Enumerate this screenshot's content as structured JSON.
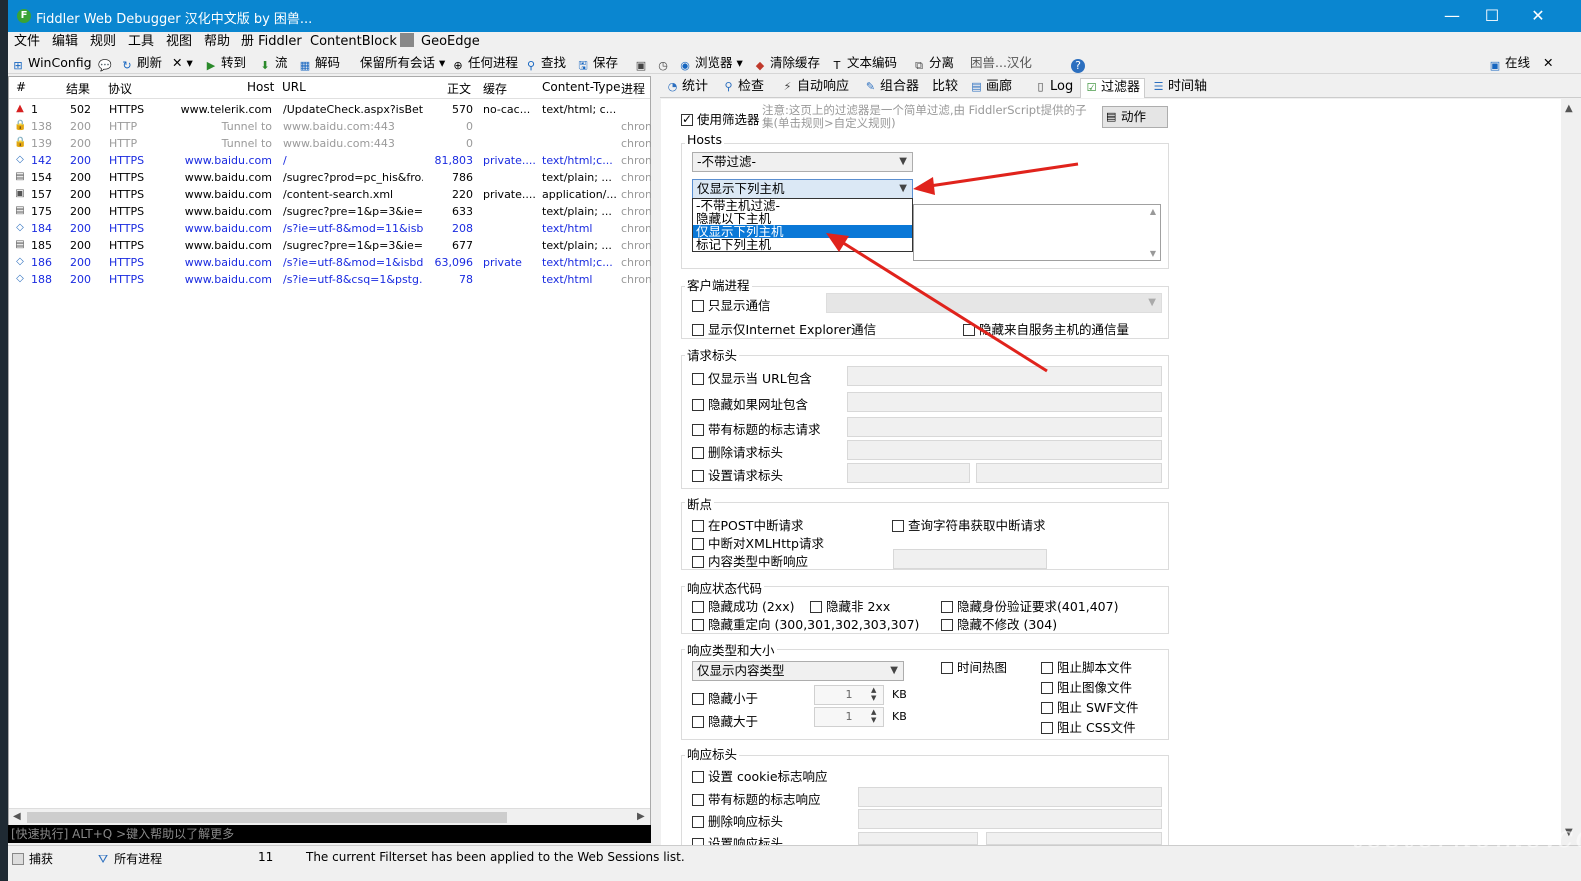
{
  "window": {
    "title": "Fiddler Web Debugger 汉化中文版 by 困兽...",
    "min": "—",
    "max": "☐",
    "close": "✕"
  },
  "menu": [
    "文件",
    "编辑",
    "规则",
    "工具",
    "视图",
    "帮助",
    "册 Fiddler",
    "ContentBlock",
    "GeoEdge"
  ],
  "toolbar": {
    "winconfig": "WinConfig",
    "refresh": "刷新",
    "remove": "✕",
    "goto": "转到",
    "stream": "流",
    "decode": "解码",
    "keep": "保留所有会话",
    "process": "任何进程",
    "find": "查找",
    "save": "保存",
    "browse": "浏览器",
    "clearcache": "清除缓存",
    "textenc": "文本编码",
    "detach": "分离",
    "hanhua": "困兽...汉化",
    "online": "在线"
  },
  "sessions": {
    "columns": [
      "#",
      "结果",
      "协议",
      "Host",
      "URL",
      "正文",
      "缓存",
      "Content-Type",
      "进程"
    ],
    "rows": [
      {
        "id": "1",
        "result": "502",
        "proto": "HTTPS",
        "host": "www.telerik.com",
        "url": "/UpdateCheck.aspx?isBet...",
        "body": "570",
        "cache": "no-cac...",
        "ctype": "text/html; c...",
        "proc": "",
        "color": "#000000",
        "icon": "warning-icon"
      },
      {
        "id": "138",
        "result": "200",
        "proto": "HTTP",
        "host": "Tunnel to",
        "url": "www.baidu.com:443",
        "body": "0",
        "cache": "",
        "ctype": "",
        "proc": "chrom",
        "color": "#9a9a9a",
        "icon": "lock-icon"
      },
      {
        "id": "139",
        "result": "200",
        "proto": "HTTP",
        "host": "Tunnel to",
        "url": "www.baidu.com:443",
        "body": "0",
        "cache": "",
        "ctype": "",
        "proc": "chrom",
        "color": "#9a9a9a",
        "icon": "lock-icon"
      },
      {
        "id": "142",
        "result": "200",
        "proto": "HTTPS",
        "host": "www.baidu.com",
        "url": "/",
        "body": "81,803",
        "cache": "private....",
        "ctype": "text/html;c...",
        "proc": "chrom",
        "color": "#1a2be0",
        "icon": "html-icon"
      },
      {
        "id": "154",
        "result": "200",
        "proto": "HTTPS",
        "host": "www.baidu.com",
        "url": "/sugrec?prod=pc_his&fro...",
        "body": "786",
        "cache": "",
        "ctype": "text/plain; ...",
        "proc": "chrom",
        "color": "#000000",
        "icon": "document-icon"
      },
      {
        "id": "157",
        "result": "200",
        "proto": "HTTPS",
        "host": "www.baidu.com",
        "url": "/content-search.xml",
        "body": "220",
        "cache": "private....",
        "ctype": "application/...",
        "proc": "chrom",
        "color": "#000000",
        "icon": "xml-icon"
      },
      {
        "id": "175",
        "result": "200",
        "proto": "HTTPS",
        "host": "www.baidu.com",
        "url": "/sugrec?pre=1&p=3&ie=...",
        "body": "633",
        "cache": "",
        "ctype": "text/plain; ...",
        "proc": "chrom",
        "color": "#000000",
        "icon": "document-icon"
      },
      {
        "id": "184",
        "result": "200",
        "proto": "HTTPS",
        "host": "www.baidu.com",
        "url": "/s?ie=utf-8&mod=11&isb...",
        "body": "208",
        "cache": "",
        "ctype": "text/html",
        "proc": "chrom",
        "color": "#1a2be0",
        "icon": "html-icon"
      },
      {
        "id": "185",
        "result": "200",
        "proto": "HTTPS",
        "host": "www.baidu.com",
        "url": "/sugrec?pre=1&p=3&ie=...",
        "body": "677",
        "cache": "",
        "ctype": "text/plain; ...",
        "proc": "chrom",
        "color": "#000000",
        "icon": "document-icon"
      },
      {
        "id": "186",
        "result": "200",
        "proto": "HTTPS",
        "host": "www.baidu.com",
        "url": "/s?ie=utf-8&mod=1&isbd...",
        "body": "63,096",
        "cache": "private",
        "ctype": "text/html;c...",
        "proc": "chrom",
        "color": "#1a2be0",
        "icon": "html-icon"
      },
      {
        "id": "188",
        "result": "200",
        "proto": "HTTPS",
        "host": "www.baidu.com",
        "url": "/s?ie=utf-8&csq=1&pstg...",
        "body": "78",
        "cache": "",
        "ctype": "text/html",
        "proc": "chrom",
        "color": "#1a2be0",
        "icon": "html-icon"
      }
    ]
  },
  "quickexec": "[快速执行] ALT+Q >键入帮助以了解更多",
  "status": {
    "capture": "捕获",
    "process": "所有进程",
    "count": "11",
    "message": "The current Filterset has been applied to the Web Sessions list."
  },
  "tabs": [
    "统计",
    "检查",
    "自动响应",
    "组合器",
    "比较",
    "画廊",
    "Log",
    "过滤器",
    "时间轴"
  ],
  "filters": {
    "use_filters": "使用筛选器",
    "note": "注意:这页上的过滤器是一个简单过滤,由 FiddlerScript提供的子集(单击规则>自定义规则)",
    "actions": "动作",
    "hosts_title": "Hosts",
    "zone_select": "-不带过滤-",
    "host_select": "仅显示下列主机",
    "host_options": [
      "-不带主机过滤-",
      "隐藏以下主机",
      "仅显示下列主机",
      "标记下列主机"
    ],
    "client_title": "客户端进程",
    "only_traffic": "只显示通信",
    "only_ie": "显示仅Internet Explorer通信",
    "hide_service": "隐藏来自服务主机的通信量",
    "req_title": "请求标头",
    "req_url_contains": "仅显示当 URL包含",
    "req_hide_url": "隐藏如果网址包含",
    "req_flag_header": "带有标题的标志请求",
    "req_delete_header": "删除请求标头",
    "req_set_header": "设置请求标头",
    "bp_title": "断点",
    "bp_post": "在POST中断请求",
    "bp_query": "查询字符串获取中断请求",
    "bp_xhr": "中断对XMLHttp请求",
    "bp_ctype": "内容类型中断响应",
    "code_title": "响应状态代码",
    "hide_2xx": "隐藏成功 (2xx)",
    "hide_non2xx": "隐藏非 2xx",
    "hide_auth": "隐藏身份验证要求(401,407)",
    "hide_redirect": "隐藏重定向 (300,301,302,303,307)",
    "hide_304": "隐藏不修改 (304)",
    "type_title": "响应类型和大小",
    "type_select": "仅显示内容类型",
    "heatmap": "时间热图",
    "block_script": "阻止脚本文件",
    "block_image": "阻止图像文件",
    "block_swf": "阻止 SWF文件",
    "block_css": "阻止 CSS文件",
    "hide_smaller": "隐藏小于",
    "hide_larger": "隐藏大于",
    "size_value": "1",
    "size_unit": "KB",
    "resp_title": "响应标头",
    "resp_cookie": "设置 cookie标志响应",
    "resp_flag": "带有标题的标志响应",
    "resp_delete": "删除响应标头",
    "resp_set": "设置响应标头"
  },
  "watermark": "testerhome.com"
}
